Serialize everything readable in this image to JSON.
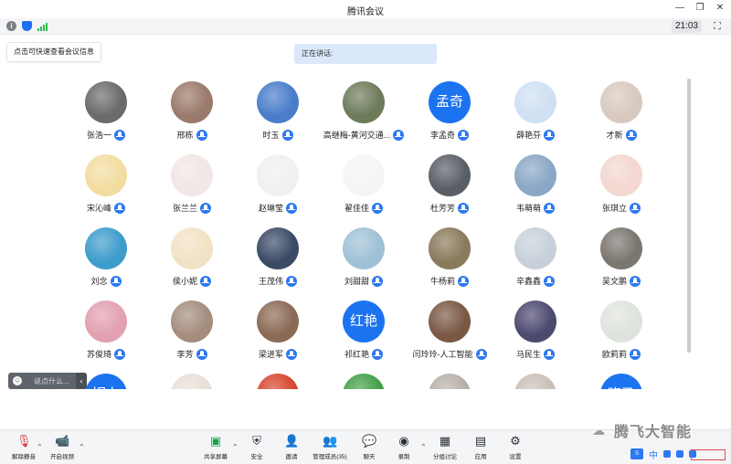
{
  "window": {
    "title": "腾讯会议"
  },
  "status": {
    "clock": "21:03"
  },
  "meeting_info_button": "点击可快速查看会议信息",
  "speaking_label": "正在讲话:",
  "participants": [
    {
      "name": "张浩一",
      "avatar": "photo",
      "color": "#6b6b6b"
    },
    {
      "name": "邢栋",
      "avatar": "photo",
      "color": "#9a7a6a"
    },
    {
      "name": "时玉",
      "avatar": "photo",
      "color": "#4a7dc9"
    },
    {
      "name": "高继梅-黄河交通...",
      "avatar": "photo",
      "color": "#6e7b5a"
    },
    {
      "name": "李孟奇",
      "avatar": "text",
      "initials": "孟奇"
    },
    {
      "name": "薛艳芬",
      "avatar": "photo",
      "color": "#cfe0f2"
    },
    {
      "name": "才新",
      "avatar": "photo",
      "color": "#d8c9bf"
    },
    {
      "name": "宋沁峰",
      "avatar": "photo",
      "color": "#f2dca0"
    },
    {
      "name": "张兰兰",
      "avatar": "photo",
      "color": "#f1e7e4"
    },
    {
      "name": "赵琳莹",
      "avatar": "photo",
      "color": "#f0f0f0"
    },
    {
      "name": "翟佳佳",
      "avatar": "photo",
      "color": "#f5f5f5"
    },
    {
      "name": "杜芳芳",
      "avatar": "photo",
      "color": "#5a5f66"
    },
    {
      "name": "韦萌萌",
      "avatar": "photo",
      "color": "#8aa7c5"
    },
    {
      "name": "张琪立",
      "avatar": "photo",
      "color": "#f3d7d0"
    },
    {
      "name": "刘念",
      "avatar": "photo",
      "color": "#3d9ccc"
    },
    {
      "name": "侯小妮",
      "avatar": "photo",
      "color": "#f2e2c5"
    },
    {
      "name": "王茂伟",
      "avatar": "photo",
      "color": "#3b4b66"
    },
    {
      "name": "刘甜甜",
      "avatar": "photo",
      "color": "#9fc1d6"
    },
    {
      "name": "牛杨莉",
      "avatar": "photo",
      "color": "#8a7a5c"
    },
    {
      "name": "辛鑫鑫",
      "avatar": "photo",
      "color": "#c7d0da"
    },
    {
      "name": "吴文鹏",
      "avatar": "photo",
      "color": "#7c7670"
    },
    {
      "name": "苏俊琦",
      "avatar": "photo",
      "color": "#e2a0b0"
    },
    {
      "name": "李芳",
      "avatar": "photo",
      "color": "#a58d7e"
    },
    {
      "name": "梁进军",
      "avatar": "photo",
      "color": "#8a6a55"
    },
    {
      "name": "祁红艳",
      "avatar": "text",
      "initials": "红艳"
    },
    {
      "name": "闫玲玲-人工智能",
      "avatar": "photo",
      "color": "#7a5844"
    },
    {
      "name": "马民生",
      "avatar": "photo",
      "color": "#4d4a70"
    },
    {
      "name": "欧莉莉",
      "avatar": "photo",
      "color": "#dfe3dd"
    },
    {
      "name": "",
      "avatar": "text",
      "initials": "妮力"
    },
    {
      "name": "",
      "avatar": "photo",
      "color": "#e8e0d6"
    },
    {
      "name": "",
      "avatar": "photo",
      "color": "#d8452f"
    },
    {
      "name": "",
      "avatar": "photo",
      "color": "#43a047"
    },
    {
      "name": "",
      "avatar": "photo",
      "color": "#b8b0a8"
    },
    {
      "name": "",
      "avatar": "photo",
      "color": "#c9c0b6"
    },
    {
      "name": "",
      "avatar": "text",
      "initials": "晓乙"
    }
  ],
  "chat": {
    "placeholder": "说点什么...",
    "expand": "‹"
  },
  "toolbar": {
    "unmute": "解除静音",
    "start_video": "开启视频",
    "share_screen": "共享屏幕",
    "security": "安全",
    "invite": "邀请",
    "manage_members": "管理成员(35)",
    "chat": "聊天",
    "record": "录制",
    "breakout": "分组讨论",
    "apps": "应用",
    "settings": "设置"
  },
  "watermark": "腾飞大智能",
  "ime": {
    "lang": "中"
  },
  "icons": {
    "info": "info-icon",
    "shield": "shield-icon",
    "signal": "signal-icon",
    "mic": "mic-icon",
    "video": "video-icon",
    "share": "share-screen-icon",
    "security": "shield-icon",
    "invite": "invite-icon",
    "members": "members-icon",
    "chat": "chat-icon",
    "record": "record-icon",
    "breakout": "breakout-icon",
    "apps": "apps-icon",
    "settings": "gear-icon"
  },
  "colors": {
    "accent": "#1b73f0",
    "mic": "#2b78f2",
    "toolbar_bg": "#f4f5f7"
  }
}
